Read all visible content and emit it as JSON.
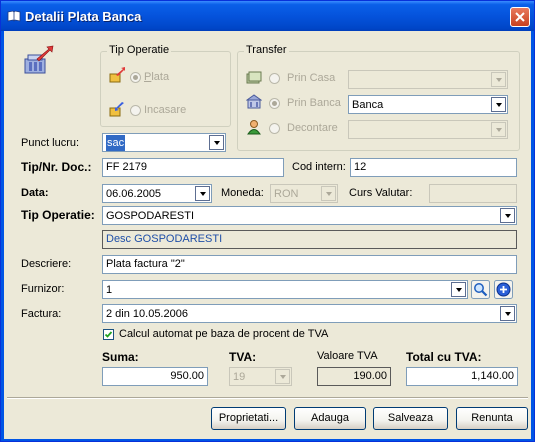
{
  "window": {
    "title": "Detalii Plata Banca"
  },
  "tip_group": {
    "title": "Tip Operatie",
    "plata": "Plata",
    "incasare": "Incasare"
  },
  "transfer_group": {
    "title": "Transfer",
    "prin_casa": "Prin Casa",
    "prin_banca": "Prin Banca",
    "banca_value": "Banca",
    "decontare": "Decontare"
  },
  "punct": {
    "label": "Punct lucru:",
    "value": "sac"
  },
  "tip_nr": {
    "label": "Tip/Nr. Doc.:",
    "value": "FF 2179",
    "cod_label": "Cod intern:",
    "cod_value": "12"
  },
  "data": {
    "label": "Data:",
    "value": "06.06.2005",
    "moneda_label": "Moneda:",
    "moneda_value": "RON",
    "curs_label": "Curs Valutar:",
    "curs_value": ""
  },
  "tip_operatie": {
    "label": "Tip Operatie:",
    "value": "GOSPODARESTI",
    "desc": "Desc GOSPODARESTI"
  },
  "descriere": {
    "label": "Descriere:",
    "value": "Plata factura \"2\""
  },
  "furnizor": {
    "label": "Furnizor:",
    "value": "1"
  },
  "factura": {
    "label": "Factura:",
    "value": "2 din 10.05.2006"
  },
  "calcul": {
    "label": "Calcul automat pe baza de procent de TVA",
    "checked": true
  },
  "totals": {
    "suma_label": "Suma:",
    "suma_value": "950.00",
    "tva_label": "TVA:",
    "tva_value": "19",
    "valoare_label": "Valoare TVA",
    "valoare_value": "190.00",
    "total_label": "Total cu TVA:",
    "total_value": "1,140.00"
  },
  "buttons": {
    "proprietati": "Proprietati...",
    "adauga": "Adauga",
    "salveaza": "Salveaza",
    "renunta": "Renunta"
  }
}
